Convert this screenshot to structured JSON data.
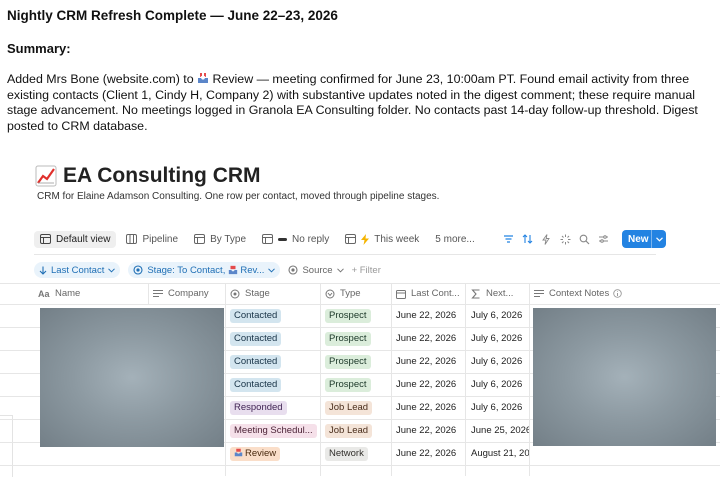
{
  "document": {
    "heading": "Nightly CRM Refresh Complete — June 22–23, 2026",
    "summary_label": "Summary:",
    "summary_before": "Added Mrs Bone (website.com) to ",
    "summary_after": " Review — meeting confirmed for June 23, 10:00am PT. Found email activity from three existing contacts (Client 1, Cindy H, Company 2) with substantive updates noted in the digest comment; these require manual stage advancement. No meetings logged in Granola EA Consulting folder. No contacts past 14-day follow-up threshold. Digest posted to CRM database."
  },
  "crm": {
    "title": "EA Consulting CRM",
    "title_icon": "chart-increasing-icon",
    "description": "CRM for Elaine Adamson Consulting. One row per contact, moved through pipeline stages.",
    "views": [
      {
        "label": "Default view",
        "icon": "table-icon",
        "active": true
      },
      {
        "label": "Pipeline",
        "icon": "board-icon",
        "active": false
      },
      {
        "label": "By Type",
        "icon": "table-icon",
        "active": false
      },
      {
        "label": "No reply",
        "icon": "table-icon",
        "active": false
      },
      {
        "label": "This week",
        "icon": "table-icon",
        "active": false
      },
      {
        "label": "5 more...",
        "icon": "",
        "active": false
      }
    ],
    "new_button": "New",
    "filters": {
      "sort_chip": "Last Contact",
      "stage_chip": "Stage: To Contact,",
      "stage_chip_suffix": "Rev...",
      "source": "Source",
      "add_filter": "+ Filter"
    },
    "columns": [
      "Name",
      "Company",
      "Stage",
      "Type",
      "Last Cont...",
      "Next...",
      "Context Notes"
    ],
    "rows": [
      {
        "stage": "Contacted",
        "type": "Prospect",
        "last_contact": "June 22, 2026",
        "next": "July 6, 2026"
      },
      {
        "stage": "Contacted",
        "type": "Prospect",
        "last_contact": "June 22, 2026",
        "next": "July 6, 2026"
      },
      {
        "stage": "Contacted",
        "type": "Prospect",
        "last_contact": "June 22, 2026",
        "next": "July 6, 2026"
      },
      {
        "stage": "Contacted",
        "type": "Prospect",
        "last_contact": "June 22, 2026",
        "next": "July 6, 2026"
      },
      {
        "stage": "Responded",
        "type": "Job Lead",
        "last_contact": "June 22, 2026",
        "next": "July 6, 2026"
      },
      {
        "stage": "Meeting Schedul...",
        "type": "Job Lead",
        "last_contact": "June 22, 2026",
        "next": "June 25, 2026"
      },
      {
        "stage": "Review",
        "type": "Network",
        "last_contact": "June 22, 2026",
        "next": "August 21, 20"
      }
    ],
    "colors": {
      "contacted_bg": "#d3e5ef",
      "contacted_fg": "#183347",
      "prospect_bg": "#dbeddb",
      "prospect_fg": "#1c3829",
      "responded_bg": "#e8deee",
      "responded_fg": "#412454",
      "meeting_bg": "#f5e0e9",
      "meeting_fg": "#4c2337",
      "review_bg": "#fadec9",
      "review_fg": "#49290e",
      "joblead_bg": "#f4e4d8",
      "joblead_fg": "#4a2e1c",
      "network_bg": "#e9e9e7",
      "network_fg": "#32302c",
      "accent": "#2383e2"
    }
  }
}
